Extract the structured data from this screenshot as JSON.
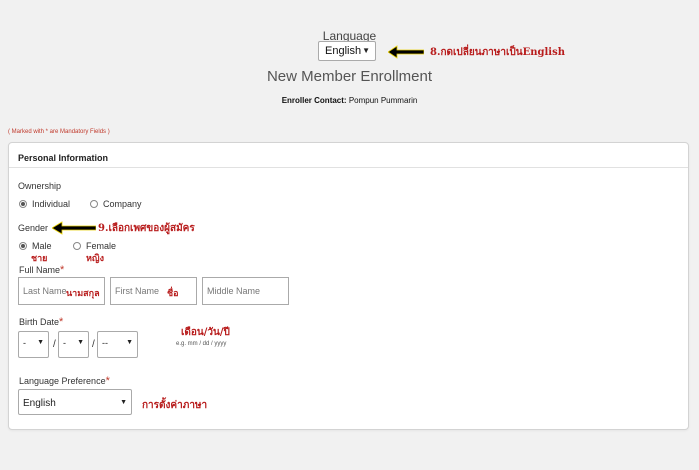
{
  "language": {
    "label": "Language",
    "selected": "English"
  },
  "page_title": "New Member Enrollment",
  "enroller": {
    "label": "Enroller Contact:",
    "name": "Pompun Pummarin"
  },
  "mandatory_note": "( Marked with * are Mandatory Fields )",
  "section_title": "Personal Information",
  "ownership": {
    "label": "Ownership",
    "options": [
      "Individual",
      "Company"
    ],
    "selected": "Individual"
  },
  "gender": {
    "label": "Gender",
    "options": [
      "Male",
      "Female"
    ],
    "selected": "Male"
  },
  "full_name": {
    "label": "Full Name",
    "placeholders": {
      "last": "Last Name",
      "first": "First Name",
      "middle": "Middle Name"
    }
  },
  "birth_date": {
    "label": "Birth Date",
    "month": "-",
    "day": "-",
    "year": "--",
    "hint": "e.g. mm / dd / yyyy",
    "separator": "/"
  },
  "language_preference": {
    "label": "Language Preference",
    "selected": "English"
  },
  "required_mark": "*",
  "annotations": {
    "step8": "8.กดเปลี่ยนภาษาเป็นEnglish",
    "step9": "9.เลือกเพศของผู้สมัคร",
    "male_th": "ชาย",
    "female_th": "หญิง",
    "lastname_th": "นามสกุล",
    "firstname_th": "ชื่อ",
    "date_th": "เดือน/วัน/ปี",
    "lang_th": "การตั้งค่าภาษา"
  },
  "colors": {
    "annotation": "#b81c1c",
    "required": "#c0392b",
    "arrow": "#000000"
  }
}
